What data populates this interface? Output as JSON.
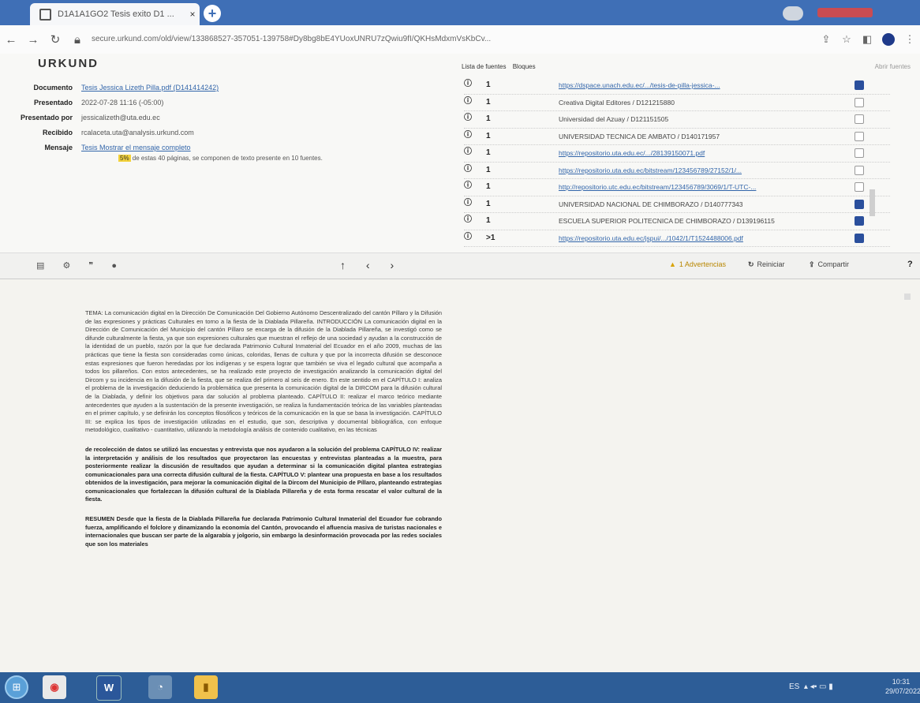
{
  "browser": {
    "tab_title": "D1A1A1GO2 Tesis exito D1 ...",
    "url": "secure.urkund.com/old/view/133868527-357051-139758#Dy8bg8bE4YUoxUNRU7zQwiu9fI/QKHsMdxmVsKbCv...",
    "new_tab": "+"
  },
  "urkund": {
    "logo": "URKUND",
    "meta": [
      {
        "label": "Documento",
        "value": "Tesis Jessica Lizeth Pilla.pdf (D141414242)",
        "link": true
      },
      {
        "label": "Presentado",
        "value": "2022-07-28 11:16 (-05:00)",
        "link": false
      },
      {
        "label": "Presentado por",
        "value": "jessicalizeth@uta.edu.ec",
        "link": false
      },
      {
        "label": "Recibido",
        "value": "rcalaceta.uta@analysis.urkund.com",
        "link": false
      },
      {
        "label": "Mensaje",
        "value": "Tesis Mostrar el mensaje completo",
        "link": true
      }
    ],
    "warning_pct": "5%",
    "warning_text": "de estas 40 páginas, se componen de texto presente en 10 fuentes.",
    "sources_header": [
      "Lista de fuentes",
      "Bloques"
    ],
    "expand_label": "Abrir fuentes",
    "sources": [
      {
        "count": "1",
        "name": "https://dspace.unach.edu.ec/.../tesis-de-pilla-jessica-...",
        "link": true,
        "checked": true
      },
      {
        "count": "1",
        "name": "Creativa Digital Editores / D121215880",
        "link": false,
        "checked": false
      },
      {
        "count": "1",
        "name": "Universidad del Azuay / D121151505",
        "link": false,
        "checked": false
      },
      {
        "count": "1",
        "name": "UNIVERSIDAD TECNICA DE AMBATO / D140171957",
        "link": false,
        "checked": false
      },
      {
        "count": "1",
        "name": "https://repositorio.uta.edu.ec/.../28139150071.pdf",
        "link": true,
        "checked": false
      },
      {
        "count": "1",
        "name": "https://repositorio.uta.edu.ec/bitstream/123456789/27152/1/...",
        "link": true,
        "checked": false
      },
      {
        "count": "1",
        "name": "http://repositorio.utc.edu.ec/bitstream/123456789/3069/1/T-UTC-...",
        "link": true,
        "checked": false
      },
      {
        "count": "1",
        "name": "UNIVERSIDAD NACIONAL DE CHIMBORAZO / D140777343",
        "link": false,
        "checked": true
      },
      {
        "count": "1",
        "name": "ESCUELA SUPERIOR POLITECNICA DE CHIMBORAZO / D139196115",
        "link": false,
        "checked": true
      },
      {
        "count": ">1",
        "name": "https://repositorio.uta.edu.ec/jspui/.../1042/1/T1524488006.pdf",
        "link": true,
        "checked": true
      }
    ],
    "toolbar": {
      "left_icons": [
        "list-icon",
        "gear-icon",
        "quote-icon",
        "tag-icon"
      ],
      "arrows": [
        "↑",
        "‹",
        "›"
      ],
      "advertencias": "1 Advertencias",
      "reiniciar": "Reiniciar",
      "compartir": "Compartir",
      "help": "?"
    }
  },
  "document": {
    "p1": "TEMA: La comunicación digital en la Dirección De Comunicación Del Gobierno Autónomo Descentralizado del cantón Píllaro y la Difusión de las expresiones y prácticas Culturales en torno a la fiesta de la Diablada Pillareña. INTRODUCCIÓN La comunicación digital en la Dirección de Comunicación del Municipio del cantón Píllaro se encarga de la difusión de la Diablada Pillareña, se investigó como se difunde culturalmente la fiesta, ya que son expresiones culturales que muestran el reflejo de una sociedad y ayudan a la construcción de la identidad de un pueblo, razón por la que fue declarada Patrimonio Cultural Inmaterial del Ecuador en el año 2009, muchas de las prácticas que tiene la fiesta son consideradas como únicas, coloridas, llenas de cultura y que por la incorrecta difusión se desconoce estas expresiones que fueron heredadas por los indígenas y se espera lograr que también se viva el legado cultural que acompaña a todos los pillareños. Con estos antecedentes, se ha realizado este proyecto de investigación analizando la comunicación digital del Dircom y su incidencia en la difusión de la fiesta, que se realiza del primero al seis de enero. En este sentido en el CAPÍTULO I: analiza el problema de la investigación deduciendo la problemática que presenta la comunicación digital de la DIRCOM para la difusión cultural de la Diablada, y definir los objetivos para dar solución al problema planteado. CAPÍTULO II: realizar el marco teórico mediante antecedentes que ayuden a la sustentación de la presente investigación, se realiza la fundamentación teórica de las variables planteadas en el primer capítulo, y se definirán los conceptos filosóficos y teóricos de la comunicación en la que se basa la investigación. CAPÍTULO III: se explica los tipos de investigación utilizadas en el estudio, que son, descriptiva y documental bibliográfica, con enfoque metodológico, cualitativo - cuantitativo, utilizando la metodología análisis de contenido cualitativo, en las técnicas",
    "p2": "de recolección de datos se utilizó las encuestas y entrevista que nos ayudaron a la solución del problema CAPÍTULO IV: realizar la interpretación y análisis de los resultados que proyectaron las encuestas y entrevistas planteadas a la muestra, para posteriormente realizar la discusión de resultados que ayudan a determinar si la comunicación digital plantea estrategias comunicacionales para una correcta difusión cultural de la fiesta. CAPÍTULO V: plantear una propuesta en base a los resultados obtenidos de la investigación, para mejorar la comunicación digital de la Dircom del Municipio de Píllaro, planteando estrategias comunicacionales que fortalezcan la difusión cultural de la Diablada Pillareña y de esta forma rescatar el valor cultural de la fiesta.",
    "p3": "RESUMEN Desde que la fiesta de la Diablada Pillareña fue declarada Patrimonio Cultural Inmaterial del Ecuador fue cobrando fuerza, amplificando el folclore y dinamizando la economía del Cantón, provocando el afluencia masiva de turistas nacionales e internacionales que buscan ser parte de la algarabía y jolgorio, sin embargo la desinformación provocada por las redes sociales que son los materiales"
  },
  "taskbar": {
    "apps": [
      "start-button",
      "chrome",
      "word",
      "network",
      "folder"
    ],
    "word_label": "W",
    "lang": "ES",
    "time": "10:31",
    "date": "29/07/2022"
  }
}
